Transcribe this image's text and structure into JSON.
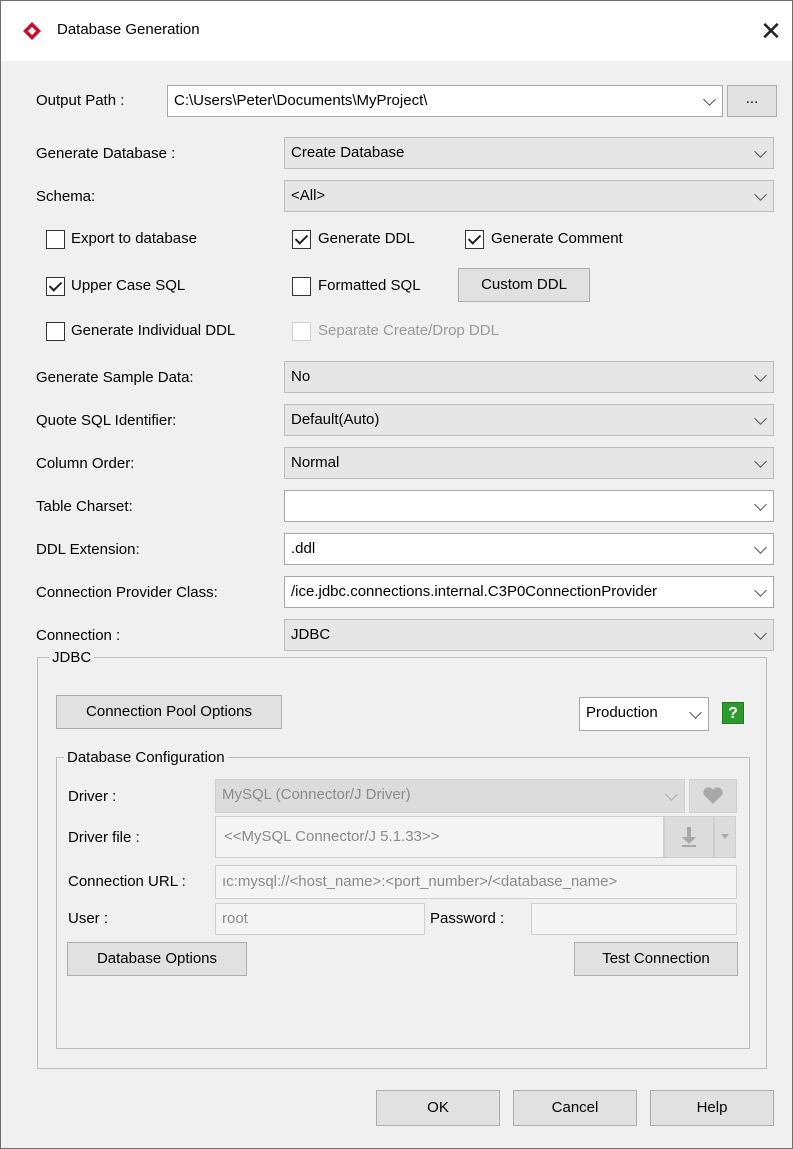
{
  "window": {
    "title": "Database Generation"
  },
  "output_path": {
    "label": "Output Path :",
    "value": "C:\\Users\\Peter\\Documents\\MyProject\\",
    "browse": "..."
  },
  "generate_database": {
    "label": "Generate Database :",
    "value": "Create Database"
  },
  "schema": {
    "label": "Schema:",
    "value": "<All>"
  },
  "checkboxes": {
    "export_to_database": {
      "label": "Export to database",
      "checked": false
    },
    "generate_ddl": {
      "label": "Generate DDL",
      "checked": true
    },
    "generate_comment": {
      "label": "Generate Comment",
      "checked": true
    },
    "upper_case_sql": {
      "label": "Upper Case SQL",
      "checked": true
    },
    "formatted_sql": {
      "label": "Formatted SQL",
      "checked": false
    },
    "generate_individual_ddl": {
      "label": "Generate Individual DDL",
      "checked": false
    },
    "separate_create_drop_ddl": {
      "label": "Separate Create/Drop DDL",
      "checked": false,
      "enabled": false
    }
  },
  "custom_ddl_button": "Custom DDL",
  "generate_sample_data": {
    "label": "Generate Sample Data:",
    "value": "No"
  },
  "quote_sql_identifier": {
    "label": "Quote SQL Identifier:",
    "value": "Default(Auto)"
  },
  "column_order": {
    "label": "Column Order:",
    "value": "Normal"
  },
  "table_charset": {
    "label": "Table Charset:",
    "value": ""
  },
  "ddl_extension": {
    "label": "DDL Extension:",
    "value": ".ddl"
  },
  "connection_provider_class": {
    "label": "Connection Provider Class:",
    "value": "/ice.jdbc.connections.internal.C3P0ConnectionProvider"
  },
  "connection": {
    "label": "Connection :",
    "value": "JDBC"
  },
  "jdbc": {
    "title": "JDBC",
    "connection_pool_button": "Connection Pool Options",
    "environment": "Production",
    "help_icon": "?",
    "db_config": {
      "title": "Database Configuration",
      "driver_label": "Driver :",
      "driver_value": "MySQL (Connector/J Driver)",
      "driver_file_label": "Driver file :",
      "driver_file_value": "<<MySQL Connector/J 5.1.33>>",
      "connection_url_label": "Connection URL :",
      "connection_url_value": "ıc:mysql://<host_name>:<port_number>/<database_name>",
      "user_label": "User :",
      "user_value": "root",
      "password_label": "Password :",
      "password_value": ""
    },
    "database_options_button": "Database Options",
    "test_connection_button": "Test Connection"
  },
  "footer": {
    "ok": "OK",
    "cancel": "Cancel",
    "help": "Help"
  },
  "colors": {
    "help_green": "#2e9a2e",
    "app_icon_red": "#c8102e"
  }
}
